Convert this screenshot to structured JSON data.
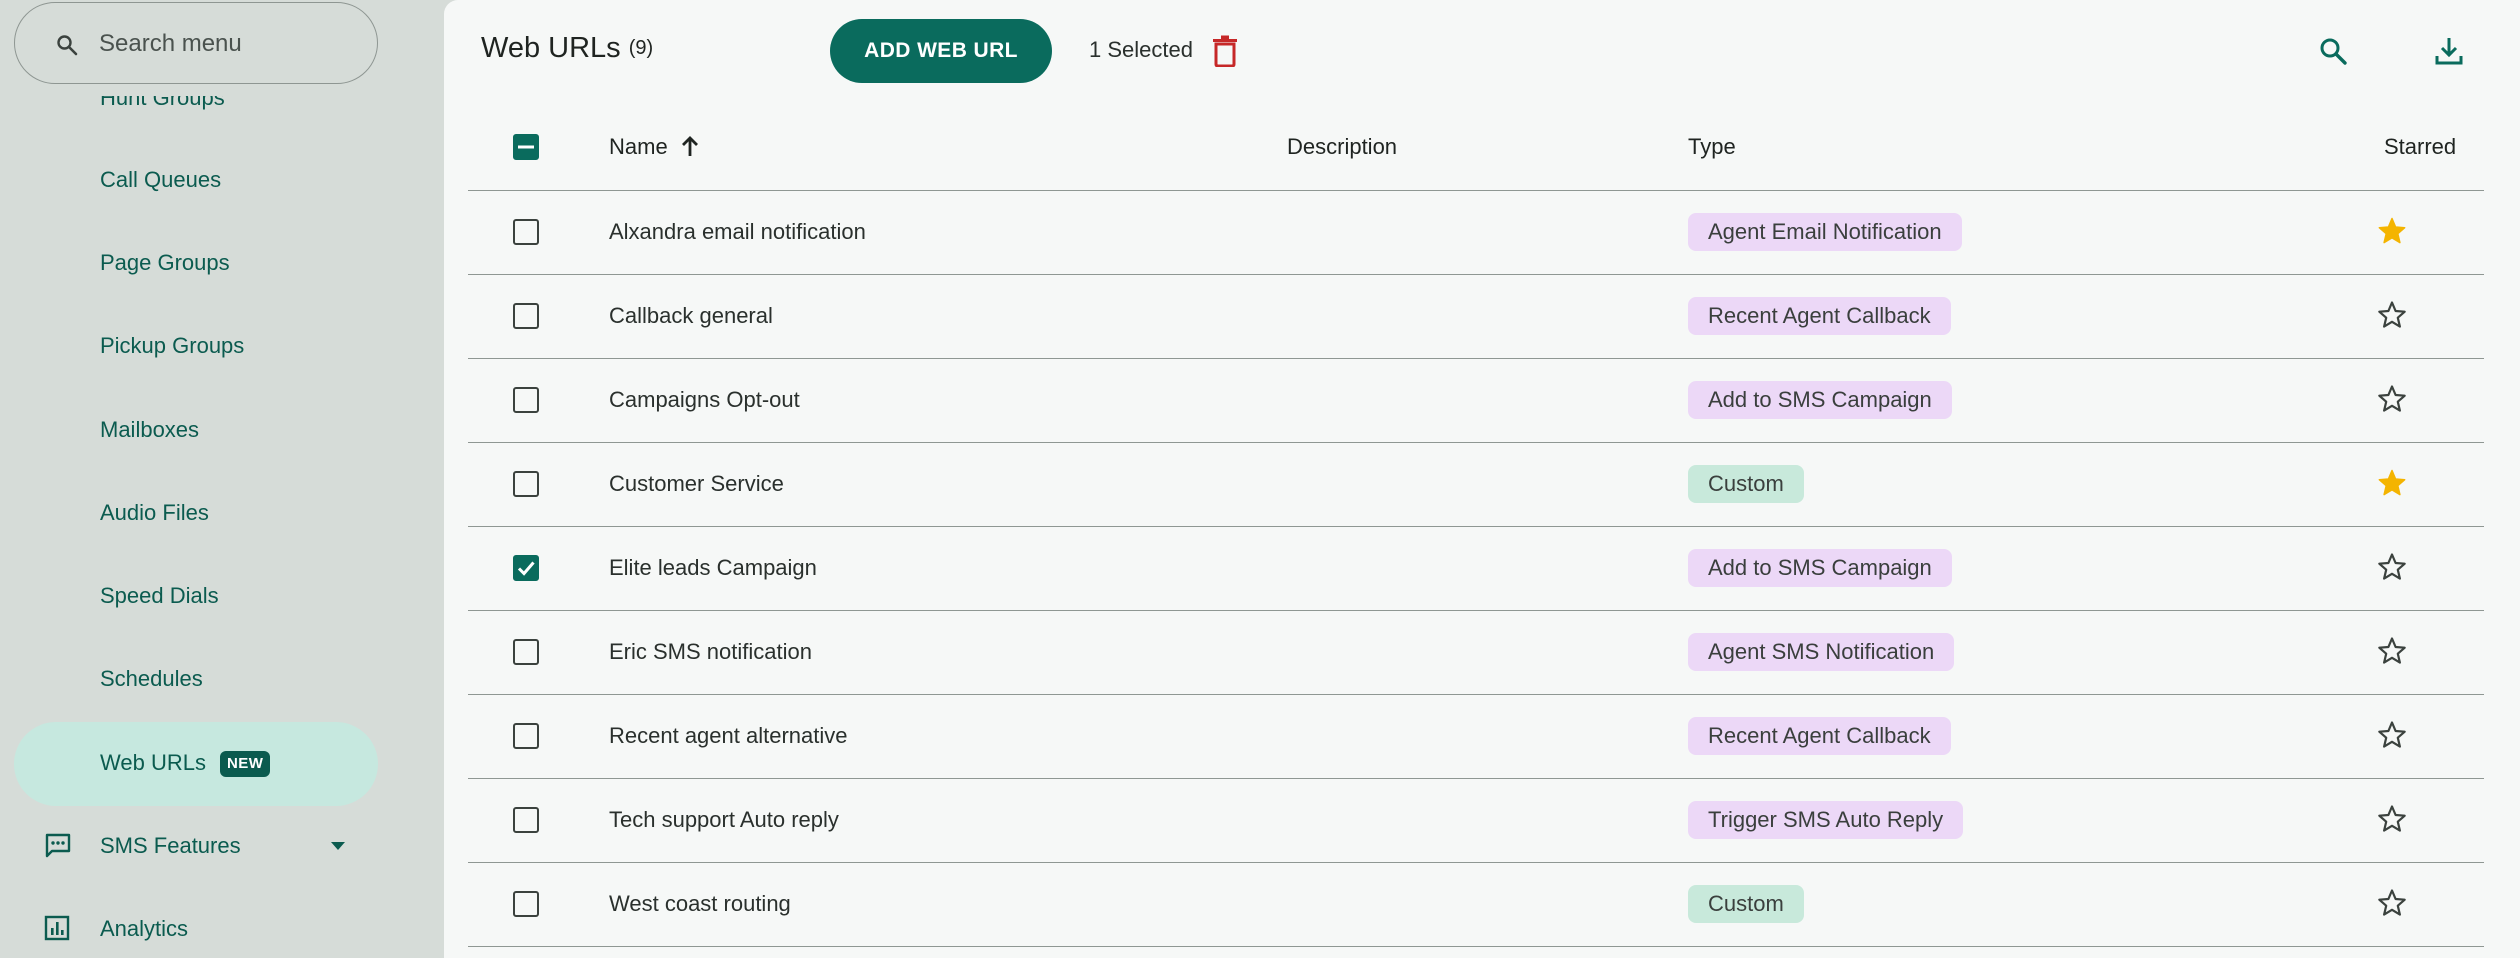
{
  "sidebar": {
    "search_placeholder": "Search menu",
    "items": [
      {
        "label": "Hunt Groups"
      },
      {
        "label": "Call Queues"
      },
      {
        "label": "Page Groups"
      },
      {
        "label": "Pickup Groups"
      },
      {
        "label": "Mailboxes"
      },
      {
        "label": "Audio Files"
      },
      {
        "label": "Speed Dials"
      },
      {
        "label": "Schedules"
      },
      {
        "label": "Web URLs",
        "badge": "NEW",
        "active": true
      },
      {
        "label": "SMS Features",
        "icon": "sms-icon",
        "expandable": true
      },
      {
        "label": "Analytics",
        "icon": "analytics-icon"
      }
    ]
  },
  "header": {
    "title": "Web URLs",
    "count": "(9)",
    "add_label": "ADD WEB URL",
    "selected_text": "1 Selected"
  },
  "table": {
    "columns": {
      "name": "Name",
      "description": "Description",
      "type": "Type",
      "starred": "Starred"
    },
    "sort": {
      "column": "Name",
      "direction": "ascending"
    },
    "rows": [
      {
        "name": "Alxandra email notification",
        "description": "",
        "type": "Agent Email Notification",
        "starred": true,
        "selected": false
      },
      {
        "name": "Callback general",
        "description": "",
        "type": "Recent Agent Callback",
        "starred": false,
        "selected": false
      },
      {
        "name": "Campaigns Opt-out",
        "description": "",
        "type": "Add to SMS Campaign",
        "starred": false,
        "selected": false
      },
      {
        "name": "Customer Service",
        "description": "",
        "type": "Custom",
        "starred": true,
        "selected": false
      },
      {
        "name": "Elite leads Campaign",
        "description": "",
        "type": "Add to SMS Campaign",
        "starred": false,
        "selected": true
      },
      {
        "name": "Eric SMS notification",
        "description": "",
        "type": "Agent SMS Notification",
        "starred": false,
        "selected": false
      },
      {
        "name": "Recent agent alternative",
        "description": "",
        "type": "Recent Agent Callback",
        "starred": false,
        "selected": false
      },
      {
        "name": "Tech support Auto reply",
        "description": "",
        "type": "Trigger SMS Auto Reply",
        "starred": false,
        "selected": false
      },
      {
        "name": "West coast routing",
        "description": "",
        "type": "Custom",
        "starred": false,
        "selected": false
      }
    ]
  },
  "colors": {
    "accent": "#0a6b5d",
    "nav_text": "#0b5b4f",
    "delete": "#c62828",
    "star": "#f4b400",
    "chip_purple": "#ecd8f7",
    "chip_green": "#c8e9db"
  }
}
